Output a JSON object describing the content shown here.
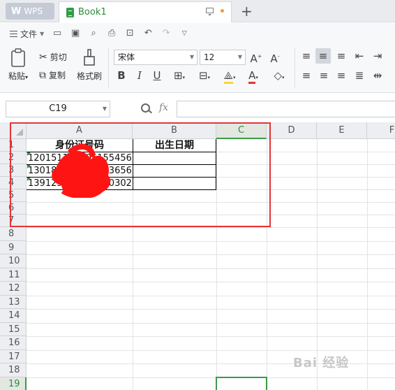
{
  "titlebar": {
    "app_label": "WPS",
    "doc_name": "Book1"
  },
  "quickbar": {
    "file_label": "文件"
  },
  "ribbon": {
    "paste": "粘贴",
    "cut": "剪切",
    "copy": "复制",
    "format_painter": "格式刷",
    "font_name": "宋体",
    "font_size": "12"
  },
  "formula": {
    "name_box": "C19",
    "fx": "fx",
    "value": ""
  },
  "columns": [
    "A",
    "B",
    "C",
    "D",
    "E",
    "F"
  ],
  "rows": [
    "1",
    "2",
    "3",
    "4",
    "5",
    "6",
    "7",
    "8",
    "9",
    "10",
    "11",
    "12",
    "13",
    "14",
    "15",
    "16",
    "17",
    "18",
    "19"
  ],
  "cells": {
    "A1": "身份证号码",
    "B1": "出生日期",
    "A2": "120151198705155456",
    "A3": "130182199404123656",
    "A4": "139125199308100302"
  },
  "active_cell": "C19",
  "watermark": "Bai 经验"
}
